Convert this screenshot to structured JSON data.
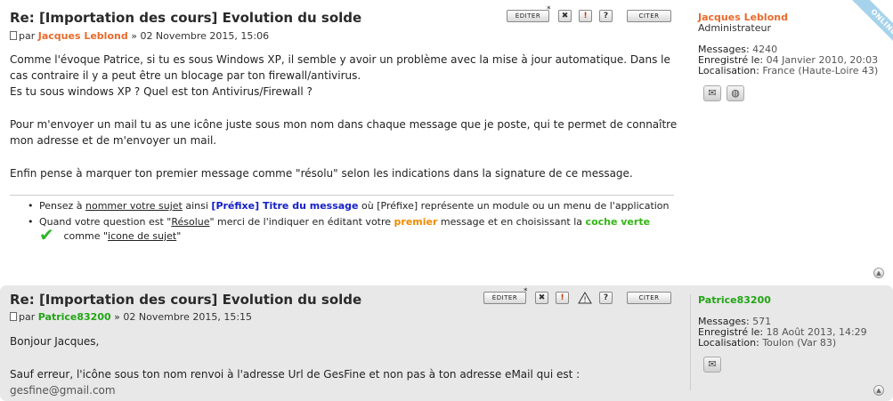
{
  "posts": [
    {
      "title": "Re: [Importation des cours] Evolution du solde",
      "byline_prefix": "par",
      "author": "Jacques Leblond",
      "byline_suffix": " » 02 Novembre 2015, 15:06",
      "buttons": {
        "edit": "ÉDITER",
        "quote": "CITER",
        "delete": "✖",
        "report": "!",
        "info": "?"
      },
      "content": [
        "Comme l'évoque Patrice, si tu es sous Windows XP, il semble y avoir un problème avec la mise à jour automatique. Dans le cas contraire il y a peut être un blocage par ton firewall/antivirus.",
        "Es tu sous windows XP ? Quel est ton Antivirus/Firewall ?",
        "Pour m'envoyer un mail tu as une icône juste sous mon nom dans chaque message que je poste, qui te permet de connaître mon adresse et de m'envoyer un mail.",
        "Enfin pense à marquer ton premier message comme \"résolu\" selon les indications dans la signature de ce message."
      ],
      "signature": {
        "item1": {
          "t1": "Pensez à ",
          "link1": "nommer votre sujet",
          "t2": " ainsi ",
          "bold_blue": "[Préfixe] Titre du message",
          "t3": " où [Préfixe] représente un module ou un menu de l'application"
        },
        "item2": {
          "t1": "Quand votre question est \"",
          "link1": "Résolue",
          "t2": "\" merci de l'indiquer en éditant votre ",
          "bold_orange": "premier",
          "t3": " message et en choisissant la ",
          "bold_green": "coche verte",
          "check": "✔",
          "t4": " comme \"",
          "link2": "icone de sujet",
          "t5": "\""
        }
      },
      "profile": {
        "name": "Jacques Leblond",
        "rank": "Administrateur",
        "messages_label": "Messages:",
        "messages": "4240",
        "registered_label": "Enregistré le:",
        "registered": "04 Janvier 2010, 20:03",
        "location_label": "Localisation:",
        "location": "France (Haute-Loire 43)",
        "online_badge": "ONLINE"
      }
    },
    {
      "title": "Re: [Importation des cours] Evolution du solde",
      "byline_prefix": "par",
      "author": "Patrice83200",
      "byline_suffix": " » 02 Novembre 2015, 15:15",
      "buttons": {
        "edit": "ÉDITER",
        "quote": "CITER",
        "delete": "✖",
        "report": "!",
        "warn": "!",
        "info": "?"
      },
      "content_line1": "Bonjour Jacques,",
      "content_line2": "Sauf erreur, l'icône sous ton nom renvoi à l'adresse Url de GesFine et non pas à ton adresse eMail qui est : ",
      "content_email": "gesfine@gmail.com",
      "profile": {
        "name": "Patrice83200",
        "messages_label": "Messages:",
        "messages": "571",
        "registered_label": "Enregistré le:",
        "registered": "18 Août 2013, 14:29",
        "location_label": "Localisation:",
        "location": "Toulon (Var 83)"
      }
    }
  ],
  "icons": {
    "email": "✉",
    "web": "◍",
    "top": "▲",
    "doc": "document-icon"
  },
  "colors": {
    "author_orange": "#ea6a2c",
    "author_green": "#22a516",
    "online_band": "#a6d3ec"
  }
}
